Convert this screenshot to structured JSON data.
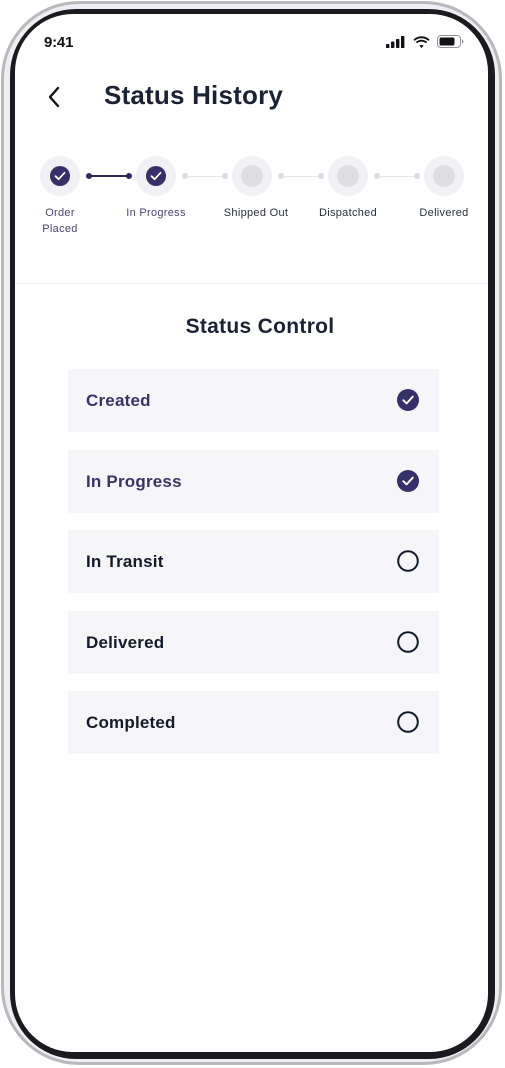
{
  "status_bar": {
    "time": "9:41"
  },
  "header": {
    "title": "Status History",
    "back_icon": "chevron-left-icon"
  },
  "stepper": {
    "steps": [
      {
        "label": "Order Placed",
        "completed": true
      },
      {
        "label": "In Progress",
        "completed": true
      },
      {
        "label": "Shipped Out",
        "completed": false
      },
      {
        "label": "Dispatched",
        "completed": false
      },
      {
        "label": "Delivered",
        "completed": false
      }
    ]
  },
  "status_control": {
    "title": "Status Control",
    "items": [
      {
        "label": "Created",
        "checked": true
      },
      {
        "label": "In Progress",
        "checked": true
      },
      {
        "label": "In Transit",
        "checked": false
      },
      {
        "label": "Delivered",
        "checked": false
      },
      {
        "label": "Completed",
        "checked": false
      }
    ]
  },
  "colors": {
    "accent": "#372f67",
    "text_dark": "#1a2233",
    "row_bg": "#f6f6f9",
    "step_inactive": "#dedee3"
  }
}
